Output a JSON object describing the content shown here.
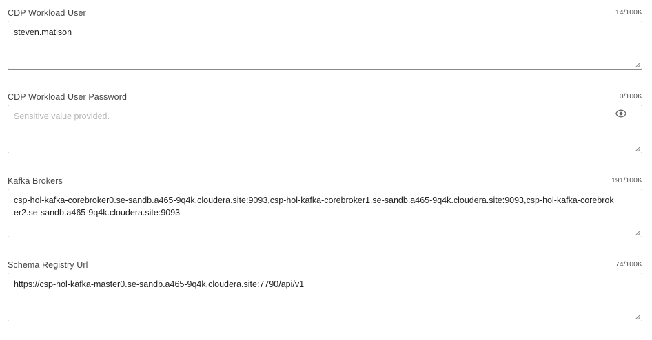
{
  "fields": [
    {
      "label": "CDP Workload User",
      "count": "14/100K",
      "value": "steven.matison"
    },
    {
      "label": "CDP Workload User Password",
      "count": "0/100K",
      "placeholder": "Sensitive value provided.",
      "icon": "eye-icon"
    },
    {
      "label": "Kafka Brokers",
      "count": "191/100K",
      "value": "csp-hol-kafka-corebroker0.se-sandb.a465-9q4k.cloudera.site:9093,csp-hol-kafka-corebroker1.se-sandb.a465-9q4k.cloudera.site:9093,csp-hol-kafka-corebroker2.se-sandb.a465-9q4k.cloudera.site:9093"
    },
    {
      "label": "Schema Registry Url",
      "count": "74/100K",
      "value": "https://csp-hol-kafka-master0.se-sandb.a465-9q4k.cloudera.site:7790/api/v1"
    }
  ],
  "colors": {
    "focus_border": "#1f6fa8",
    "border": "#8a8a8a",
    "label": "#444444",
    "placeholder": "#b5b5b5"
  }
}
